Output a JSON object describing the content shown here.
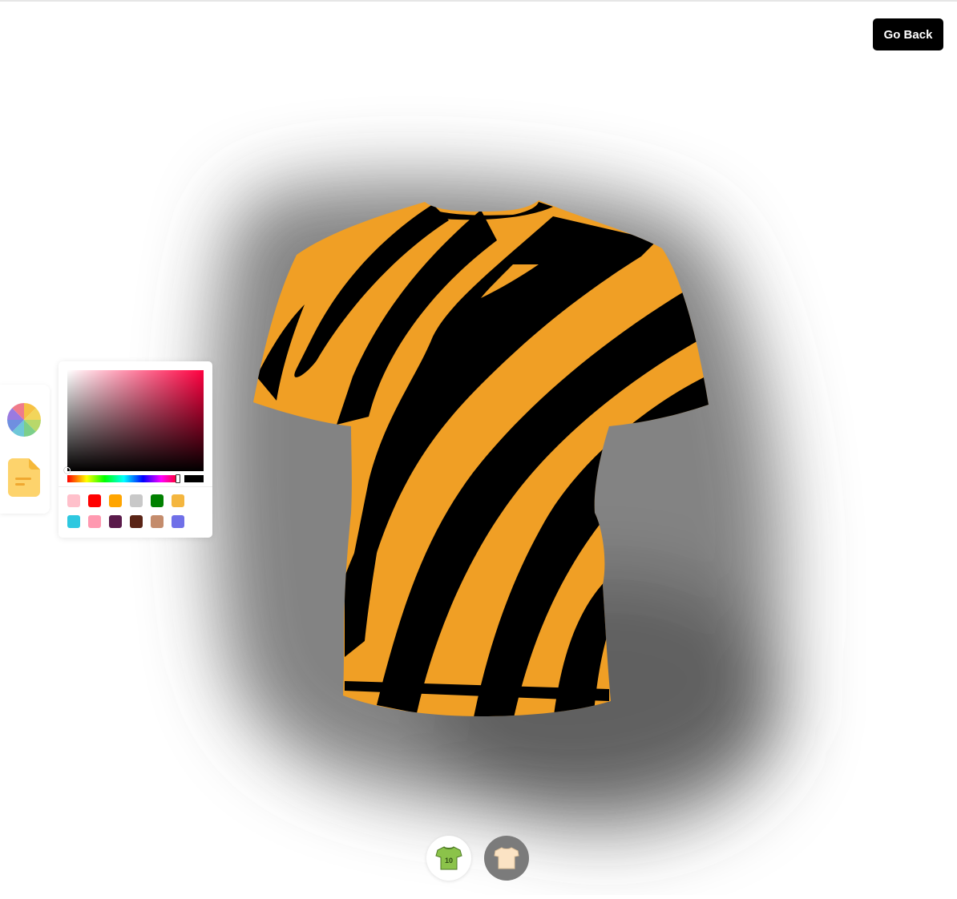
{
  "header": {
    "go_back_label": "Go Back"
  },
  "toolbar": {
    "tools": [
      {
        "icon": "color-wheel-icon"
      },
      {
        "icon": "file-icon",
        "color": "#fdd36c"
      }
    ]
  },
  "color_picker": {
    "hue_color": "#ff0040",
    "selected_color": "#000000",
    "swatches": [
      "#ffc0cb",
      "#ff0000",
      "#ffa500",
      "#c8c8c8",
      "#008000",
      "#f4b63f",
      "#2ec8e0",
      "#ff99b0",
      "#5a1a4a",
      "#5a2416",
      "#c48c6c",
      "#7070e8"
    ]
  },
  "shirt": {
    "primary_color": "#f09f25",
    "stripe_color": "#000000"
  },
  "bottom_nav": [
    {
      "icon": "jersey-10-icon",
      "label": "10"
    },
    {
      "icon": "tshirt-icon"
    }
  ]
}
